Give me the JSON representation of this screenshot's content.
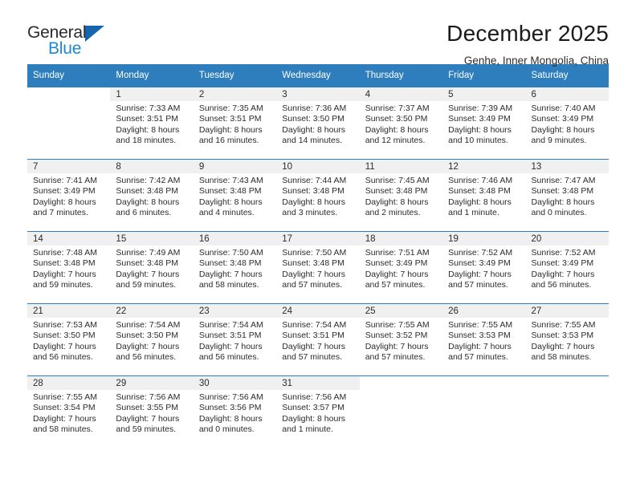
{
  "brand": {
    "name_top": "General",
    "name_bottom": "Blue",
    "triangle_color": "#1565b0",
    "blue_color": "#1f88d4"
  },
  "header": {
    "title": "December 2025",
    "subtitle": "Genhe, Inner Mongolia, China"
  },
  "theme": {
    "header_bg": "#2e7ebd",
    "header_text": "#ffffff",
    "daynum_bg": "#f0f0f0",
    "cell_bg": "#ffffff",
    "text": "#2b2b2b"
  },
  "calendar": {
    "weekday_headers": [
      "Sunday",
      "Monday",
      "Tuesday",
      "Wednesday",
      "Thursday",
      "Friday",
      "Saturday"
    ],
    "weeks": [
      [
        {
          "day": "",
          "sunrise": "",
          "sunset": "",
          "daylight1": "",
          "daylight2": "",
          "blank": true
        },
        {
          "day": "1",
          "sunrise": "Sunrise: 7:33 AM",
          "sunset": "Sunset: 3:51 PM",
          "daylight1": "Daylight: 8 hours",
          "daylight2": "and 18 minutes."
        },
        {
          "day": "2",
          "sunrise": "Sunrise: 7:35 AM",
          "sunset": "Sunset: 3:51 PM",
          "daylight1": "Daylight: 8 hours",
          "daylight2": "and 16 minutes."
        },
        {
          "day": "3",
          "sunrise": "Sunrise: 7:36 AM",
          "sunset": "Sunset: 3:50 PM",
          "daylight1": "Daylight: 8 hours",
          "daylight2": "and 14 minutes."
        },
        {
          "day": "4",
          "sunrise": "Sunrise: 7:37 AM",
          "sunset": "Sunset: 3:50 PM",
          "daylight1": "Daylight: 8 hours",
          "daylight2": "and 12 minutes."
        },
        {
          "day": "5",
          "sunrise": "Sunrise: 7:39 AM",
          "sunset": "Sunset: 3:49 PM",
          "daylight1": "Daylight: 8 hours",
          "daylight2": "and 10 minutes."
        },
        {
          "day": "6",
          "sunrise": "Sunrise: 7:40 AM",
          "sunset": "Sunset: 3:49 PM",
          "daylight1": "Daylight: 8 hours",
          "daylight2": "and 9 minutes."
        }
      ],
      [
        {
          "day": "7",
          "sunrise": "Sunrise: 7:41 AM",
          "sunset": "Sunset: 3:49 PM",
          "daylight1": "Daylight: 8 hours",
          "daylight2": "and 7 minutes."
        },
        {
          "day": "8",
          "sunrise": "Sunrise: 7:42 AM",
          "sunset": "Sunset: 3:48 PM",
          "daylight1": "Daylight: 8 hours",
          "daylight2": "and 6 minutes."
        },
        {
          "day": "9",
          "sunrise": "Sunrise: 7:43 AM",
          "sunset": "Sunset: 3:48 PM",
          "daylight1": "Daylight: 8 hours",
          "daylight2": "and 4 minutes."
        },
        {
          "day": "10",
          "sunrise": "Sunrise: 7:44 AM",
          "sunset": "Sunset: 3:48 PM",
          "daylight1": "Daylight: 8 hours",
          "daylight2": "and 3 minutes."
        },
        {
          "day": "11",
          "sunrise": "Sunrise: 7:45 AM",
          "sunset": "Sunset: 3:48 PM",
          "daylight1": "Daylight: 8 hours",
          "daylight2": "and 2 minutes."
        },
        {
          "day": "12",
          "sunrise": "Sunrise: 7:46 AM",
          "sunset": "Sunset: 3:48 PM",
          "daylight1": "Daylight: 8 hours",
          "daylight2": "and 1 minute."
        },
        {
          "day": "13",
          "sunrise": "Sunrise: 7:47 AM",
          "sunset": "Sunset: 3:48 PM",
          "daylight1": "Daylight: 8 hours",
          "daylight2": "and 0 minutes."
        }
      ],
      [
        {
          "day": "14",
          "sunrise": "Sunrise: 7:48 AM",
          "sunset": "Sunset: 3:48 PM",
          "daylight1": "Daylight: 7 hours",
          "daylight2": "and 59 minutes."
        },
        {
          "day": "15",
          "sunrise": "Sunrise: 7:49 AM",
          "sunset": "Sunset: 3:48 PM",
          "daylight1": "Daylight: 7 hours",
          "daylight2": "and 59 minutes."
        },
        {
          "day": "16",
          "sunrise": "Sunrise: 7:50 AM",
          "sunset": "Sunset: 3:48 PM",
          "daylight1": "Daylight: 7 hours",
          "daylight2": "and 58 minutes."
        },
        {
          "day": "17",
          "sunrise": "Sunrise: 7:50 AM",
          "sunset": "Sunset: 3:48 PM",
          "daylight1": "Daylight: 7 hours",
          "daylight2": "and 57 minutes."
        },
        {
          "day": "18",
          "sunrise": "Sunrise: 7:51 AM",
          "sunset": "Sunset: 3:49 PM",
          "daylight1": "Daylight: 7 hours",
          "daylight2": "and 57 minutes."
        },
        {
          "day": "19",
          "sunrise": "Sunrise: 7:52 AM",
          "sunset": "Sunset: 3:49 PM",
          "daylight1": "Daylight: 7 hours",
          "daylight2": "and 57 minutes."
        },
        {
          "day": "20",
          "sunrise": "Sunrise: 7:52 AM",
          "sunset": "Sunset: 3:49 PM",
          "daylight1": "Daylight: 7 hours",
          "daylight2": "and 56 minutes."
        }
      ],
      [
        {
          "day": "21",
          "sunrise": "Sunrise: 7:53 AM",
          "sunset": "Sunset: 3:50 PM",
          "daylight1": "Daylight: 7 hours",
          "daylight2": "and 56 minutes."
        },
        {
          "day": "22",
          "sunrise": "Sunrise: 7:54 AM",
          "sunset": "Sunset: 3:50 PM",
          "daylight1": "Daylight: 7 hours",
          "daylight2": "and 56 minutes."
        },
        {
          "day": "23",
          "sunrise": "Sunrise: 7:54 AM",
          "sunset": "Sunset: 3:51 PM",
          "daylight1": "Daylight: 7 hours",
          "daylight2": "and 56 minutes."
        },
        {
          "day": "24",
          "sunrise": "Sunrise: 7:54 AM",
          "sunset": "Sunset: 3:51 PM",
          "daylight1": "Daylight: 7 hours",
          "daylight2": "and 57 minutes."
        },
        {
          "day": "25",
          "sunrise": "Sunrise: 7:55 AM",
          "sunset": "Sunset: 3:52 PM",
          "daylight1": "Daylight: 7 hours",
          "daylight2": "and 57 minutes."
        },
        {
          "day": "26",
          "sunrise": "Sunrise: 7:55 AM",
          "sunset": "Sunset: 3:53 PM",
          "daylight1": "Daylight: 7 hours",
          "daylight2": "and 57 minutes."
        },
        {
          "day": "27",
          "sunrise": "Sunrise: 7:55 AM",
          "sunset": "Sunset: 3:53 PM",
          "daylight1": "Daylight: 7 hours",
          "daylight2": "and 58 minutes."
        }
      ],
      [
        {
          "day": "28",
          "sunrise": "Sunrise: 7:55 AM",
          "sunset": "Sunset: 3:54 PM",
          "daylight1": "Daylight: 7 hours",
          "daylight2": "and 58 minutes."
        },
        {
          "day": "29",
          "sunrise": "Sunrise: 7:56 AM",
          "sunset": "Sunset: 3:55 PM",
          "daylight1": "Daylight: 7 hours",
          "daylight2": "and 59 minutes."
        },
        {
          "day": "30",
          "sunrise": "Sunrise: 7:56 AM",
          "sunset": "Sunset: 3:56 PM",
          "daylight1": "Daylight: 8 hours",
          "daylight2": "and 0 minutes."
        },
        {
          "day": "31",
          "sunrise": "Sunrise: 7:56 AM",
          "sunset": "Sunset: 3:57 PM",
          "daylight1": "Daylight: 8 hours",
          "daylight2": "and 1 minute."
        },
        {
          "day": "",
          "sunrise": "",
          "sunset": "",
          "daylight1": "",
          "daylight2": "",
          "blank": true
        },
        {
          "day": "",
          "sunrise": "",
          "sunset": "",
          "daylight1": "",
          "daylight2": "",
          "blank": true
        },
        {
          "day": "",
          "sunrise": "",
          "sunset": "",
          "daylight1": "",
          "daylight2": "",
          "blank": true
        }
      ]
    ]
  }
}
